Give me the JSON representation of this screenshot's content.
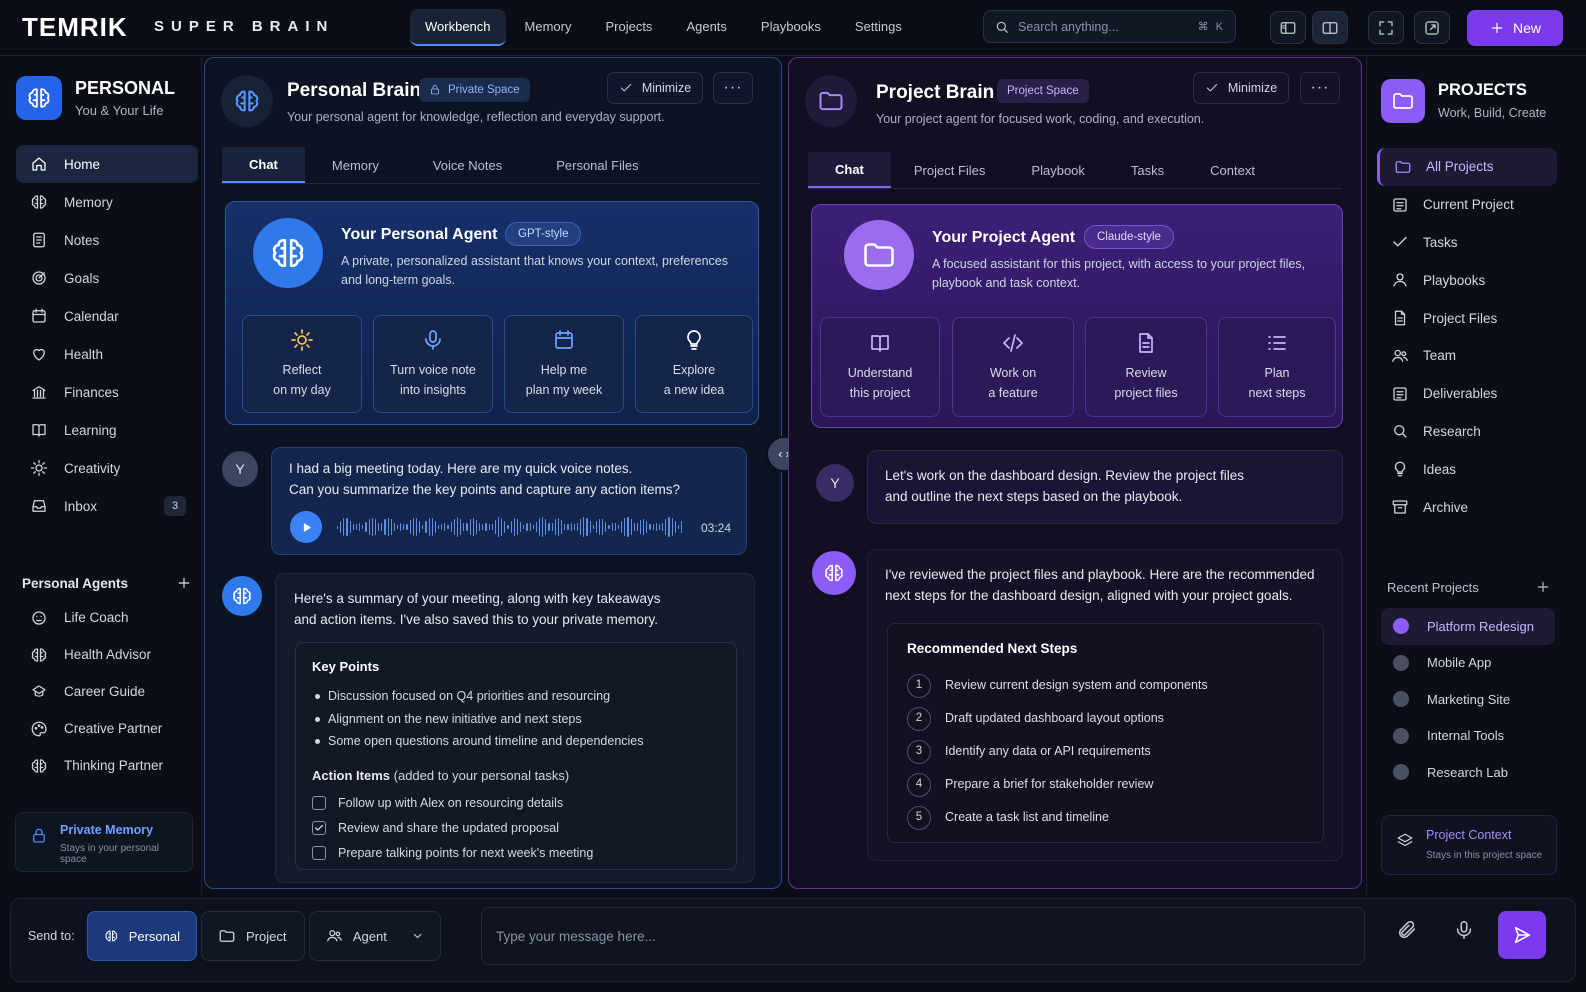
{
  "brand": {
    "logo": "TEMRIK",
    "sublogo": "SUPER BRAIN"
  },
  "topnav": {
    "items": [
      "Workbench",
      "Memory",
      "Projects",
      "Agents",
      "Playbooks",
      "Settings"
    ]
  },
  "search": {
    "placeholder": "Search anything...",
    "shortcut": "⌘ K"
  },
  "new_button": "New",
  "left": {
    "title": "PERSONAL",
    "subtitle": "You & Your Life",
    "nav": [
      {
        "label": "Home"
      },
      {
        "label": "Memory"
      },
      {
        "label": "Notes"
      },
      {
        "label": "Goals"
      },
      {
        "label": "Calendar"
      },
      {
        "label": "Health"
      },
      {
        "label": "Finances"
      },
      {
        "label": "Learning"
      },
      {
        "label": "Creativity"
      },
      {
        "label": "Inbox",
        "count": "3"
      }
    ],
    "agents_title": "Personal Agents",
    "agents": [
      "Life Coach",
      "Health Advisor",
      "Career Guide",
      "Creative Partner",
      "Thinking Partner"
    ],
    "memory_card": {
      "title": "Private Memory",
      "subtitle": "Stays in your personal space"
    }
  },
  "personal": {
    "title": "Personal Brain",
    "badge": "Private Space",
    "subtitle": "Your personal agent for knowledge, reflection and everyday support.",
    "minimize": "Minimize",
    "tabs": [
      "Chat",
      "Memory",
      "Voice Notes",
      "Personal Files"
    ],
    "agent": {
      "title": "Your Personal Agent",
      "tag": "GPT-style",
      "desc_line1": "A private, personalized assistant that knows your context, preferences",
      "desc_line2": "and long-term goals."
    },
    "actions": [
      {
        "l1": "Reflect",
        "l2": "on my day"
      },
      {
        "l1": "Turn voice note",
        "l2": "into insights"
      },
      {
        "l1": "Help me",
        "l2": "plan my week"
      },
      {
        "l1": "Explore",
        "l2": "a new idea"
      }
    ],
    "user_avatar": "Y",
    "user_msg_line1": "I had a big meeting today. Here are my quick voice notes.",
    "user_msg_line2": "Can you summarize the key points and capture any action items?",
    "audio_time": "03:24",
    "reply_line1": "Here's a summary of your meeting, along with key takeaways",
    "reply_line2": "and action items. I've also saved this to your private memory.",
    "key_points_title": "Key Points",
    "key_points": [
      "Discussion focused on Q4 priorities and resourcing",
      "Alignment on the new initiative and next steps",
      "Some open questions around timeline and dependencies"
    ],
    "action_title": "Action Items",
    "action_note": "(added to your personal tasks)",
    "action_items": [
      {
        "text": "Follow up with Alex on resourcing details",
        "checked": false
      },
      {
        "text": "Review and share the updated proposal",
        "checked": true
      },
      {
        "text": "Prepare talking points for next week's meeting",
        "checked": false
      }
    ]
  },
  "project": {
    "title": "Project Brain",
    "badge": "Project Space",
    "subtitle": "Your project agent for focused work, coding, and execution.",
    "minimize": "Minimize",
    "tabs": [
      "Chat",
      "Project Files",
      "Playbook",
      "Tasks",
      "Context"
    ],
    "agent": {
      "title": "Your Project Agent",
      "tag": "Claude-style",
      "desc_line1": "A focused assistant for this project, with access to your project files,",
      "desc_line2": "playbook and task context."
    },
    "actions": [
      {
        "l1": "Understand",
        "l2": "this project"
      },
      {
        "l1": "Work on",
        "l2": "a feature"
      },
      {
        "l1": "Review",
        "l2": "project files"
      },
      {
        "l1": "Plan",
        "l2": "next steps"
      }
    ],
    "user_avatar": "Y",
    "user_msg_line1": "Let's work on the dashboard design. Review the project files",
    "user_msg_line2": "and outline the next steps based on the playbook.",
    "reply_line1": "I've reviewed the project files and playbook. Here are the recommended",
    "reply_line2": "next steps for the dashboard design, aligned with your project goals.",
    "steps_title": "Recommended Next Steps",
    "steps": [
      {
        "n": "1",
        "text": "Review current design system and components"
      },
      {
        "n": "2",
        "text": "Draft updated dashboard layout options"
      },
      {
        "n": "3",
        "text": "Identify any data or API requirements"
      },
      {
        "n": "4",
        "text": "Prepare a brief for stakeholder review"
      },
      {
        "n": "5",
        "text": "Create a task list and timeline"
      }
    ]
  },
  "right": {
    "title": "PROJECTS",
    "subtitle": "Work, Build, Create",
    "nav": [
      "All Projects",
      "Current Project",
      "Tasks",
      "Playbooks",
      "Project Files",
      "Team",
      "Deliverables",
      "Research",
      "Ideas",
      "Archive"
    ],
    "recent_title": "Recent Projects",
    "recent": [
      "Platform Redesign",
      "Mobile App",
      "Marketing Site",
      "Internal Tools",
      "Research Lab"
    ],
    "context_card": {
      "title": "Project Context",
      "subtitle": "Stays in this project space"
    }
  },
  "bottom": {
    "send_to": "Send to:",
    "targets": [
      "Personal",
      "Project",
      "Agent"
    ],
    "placeholder": "Type your message here..."
  },
  "colors": {
    "personal_accent": "#2563eb",
    "project_accent": "#8b5cf6",
    "new_button": "#7c3aed"
  },
  "icons": {
    "left_nav": [
      "home-icon",
      "memory-icon",
      "notes-icon",
      "goals-icon",
      "calendar-icon",
      "health-icon",
      "finances-icon",
      "learning-icon",
      "creativity-icon",
      "inbox-icon"
    ],
    "right_nav": [
      "folder-icon",
      "file-icon",
      "check-icon",
      "playbook-icon",
      "files-icon",
      "team-icon",
      "deliverables-icon",
      "research-icon",
      "idea-icon",
      "archive-icon"
    ]
  }
}
